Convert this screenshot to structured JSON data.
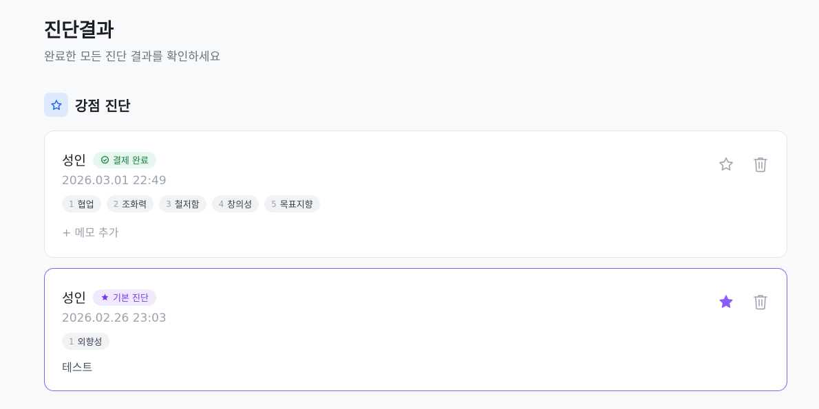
{
  "header": {
    "title": "진단결과",
    "subtitle": "완료한 모든 진단 결과를 확인하세요"
  },
  "section": {
    "icon": "star-outline-icon",
    "title": "강점 진단"
  },
  "colors": {
    "accent_blue": "#2563eb",
    "accent_purple": "#8b5cf6",
    "success_green": "#15803d"
  },
  "results": [
    {
      "name": "성인",
      "badge": {
        "label": "결제 완료",
        "icon": "check-circle-icon",
        "tone": "green"
      },
      "date": "2026.03.01 22:49",
      "tags": [
        {
          "num": "1",
          "label": "협업"
        },
        {
          "num": "2",
          "label": "조화력"
        },
        {
          "num": "3",
          "label": "철저함"
        },
        {
          "num": "4",
          "label": "창의성"
        },
        {
          "num": "5",
          "label": "목표지향"
        }
      ],
      "memo_action": "+ 메모 추가",
      "favorite": false
    },
    {
      "name": "성인",
      "badge": {
        "label": "기본 진단",
        "icon": "star-filled-icon",
        "tone": "purple"
      },
      "date": "2026.02.26 23:03",
      "tags": [
        {
          "num": "1",
          "label": "외향성"
        }
      ],
      "memo": "테스트",
      "favorite": true
    }
  ]
}
